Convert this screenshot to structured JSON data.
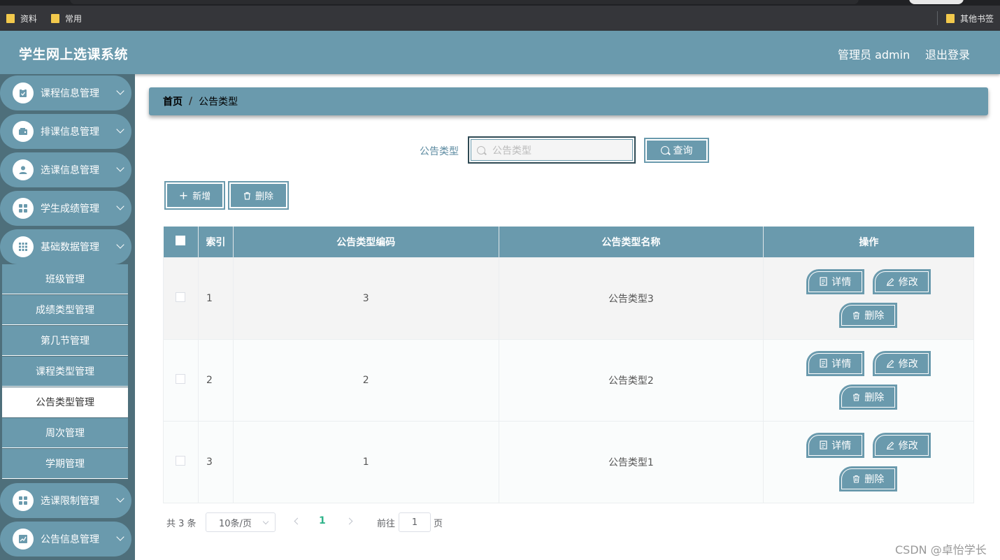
{
  "browser": {
    "bookmarks": [
      {
        "label": "资料"
      },
      {
        "label": "常用"
      }
    ],
    "other_bookmarks": "其他书签"
  },
  "header": {
    "title": "学生网上选课系统",
    "user": "管理员 admin",
    "logout": "退出登录"
  },
  "sidebar": {
    "items": [
      {
        "label": "课程信息管理",
        "icon": "clipboard-icon"
      },
      {
        "label": "排课信息管理",
        "icon": "wallet-icon"
      },
      {
        "label": "选课信息管理",
        "icon": "user-icon"
      },
      {
        "label": "学生成绩管理",
        "icon": "grid-icon"
      },
      {
        "label": "基础数据管理",
        "icon": "apps-icon"
      },
      {
        "label": "选课限制管理",
        "icon": "grid-icon"
      },
      {
        "label": "公告信息管理",
        "icon": "chart-icon"
      }
    ],
    "submenu": [
      {
        "label": "班级管理"
      },
      {
        "label": "成绩类型管理"
      },
      {
        "label": "第几节管理"
      },
      {
        "label": "课程类型管理"
      },
      {
        "label": "公告类型管理",
        "active": true
      },
      {
        "label": "周次管理"
      },
      {
        "label": "学期管理"
      }
    ]
  },
  "breadcrumb": {
    "home": "首页",
    "separator": "/",
    "current": "公告类型"
  },
  "search": {
    "label": "公告类型",
    "placeholder": "公告类型",
    "button": "查询"
  },
  "actions": {
    "add": "新增",
    "delete": "删除"
  },
  "table": {
    "columns": [
      "索引",
      "公告类型编码",
      "公告类型名称",
      "操作"
    ],
    "rows": [
      {
        "index": "1",
        "code": "3",
        "name": "公告类型3"
      },
      {
        "index": "2",
        "code": "2",
        "name": "公告类型2"
      },
      {
        "index": "3",
        "code": "1",
        "name": "公告类型1"
      }
    ],
    "row_actions": {
      "detail": "详情",
      "edit": "修改",
      "delete": "删除"
    }
  },
  "pagination": {
    "total": "共 3 条",
    "page_size": "10条/页",
    "current_page": "1",
    "goto_label": "前往",
    "goto_value": "1",
    "page_unit": "页"
  },
  "watermark": "CSDN @卓怡学长",
  "colors": {
    "primary": "#6a9aad",
    "sidebar_bg": "#4e6f7b",
    "active_page": "#2fb38a"
  }
}
